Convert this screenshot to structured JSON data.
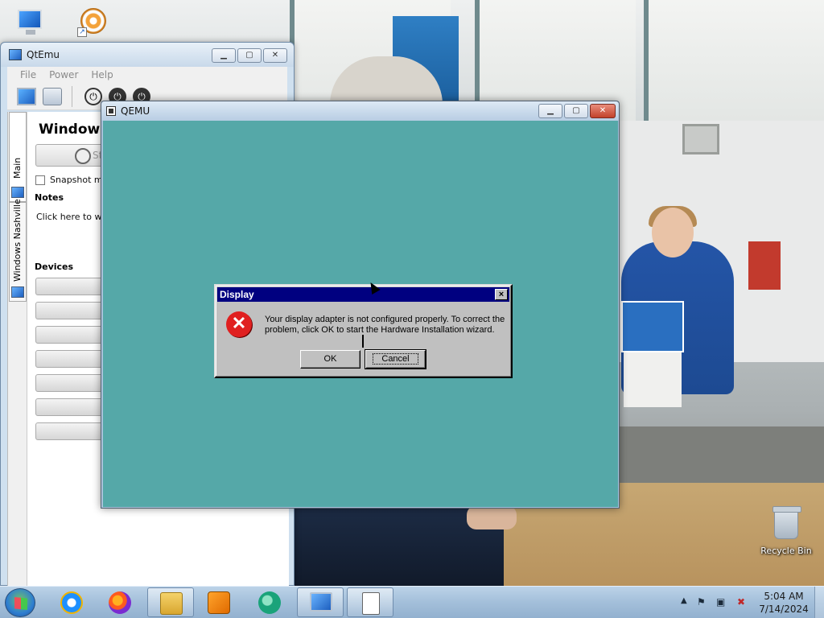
{
  "desktop": {
    "recycle_bin_label": "Recycle Bin"
  },
  "qtemu": {
    "title": "QtEmu",
    "menu": [
      "File",
      "Power",
      "Help"
    ],
    "side_tabs": [
      "Main",
      "Windows Nashville"
    ],
    "vm_title": "Windows",
    "start_label": "St",
    "snapshot_label": "Snapshot mo",
    "notes_label": "Notes",
    "notes_placeholder": "Click here to writ",
    "devices_label": "Devices"
  },
  "qemu": {
    "title": "QEMU",
    "screen_color": "#55a8a8",
    "dialog": {
      "title": "Display",
      "close_label": "×",
      "message": "Your display adapter is not configured properly.  To correct the problem, click OK to start the Hardware Installation wizard.",
      "ok_label": "OK",
      "cancel_label": "Cancel",
      "icon": "error-icon"
    }
  },
  "taskbar": {
    "apps": [
      {
        "name": "internet-explorer",
        "active": false
      },
      {
        "name": "firefox",
        "active": false
      },
      {
        "name": "file-explorer",
        "active": true
      },
      {
        "name": "media-player",
        "active": false
      },
      {
        "name": "green-app",
        "active": false
      },
      {
        "name": "qtemu",
        "active": false
      },
      {
        "name": "qemu",
        "active": true
      }
    ],
    "clock": {
      "time": "5:04 AM",
      "date": "7/14/2024"
    }
  }
}
